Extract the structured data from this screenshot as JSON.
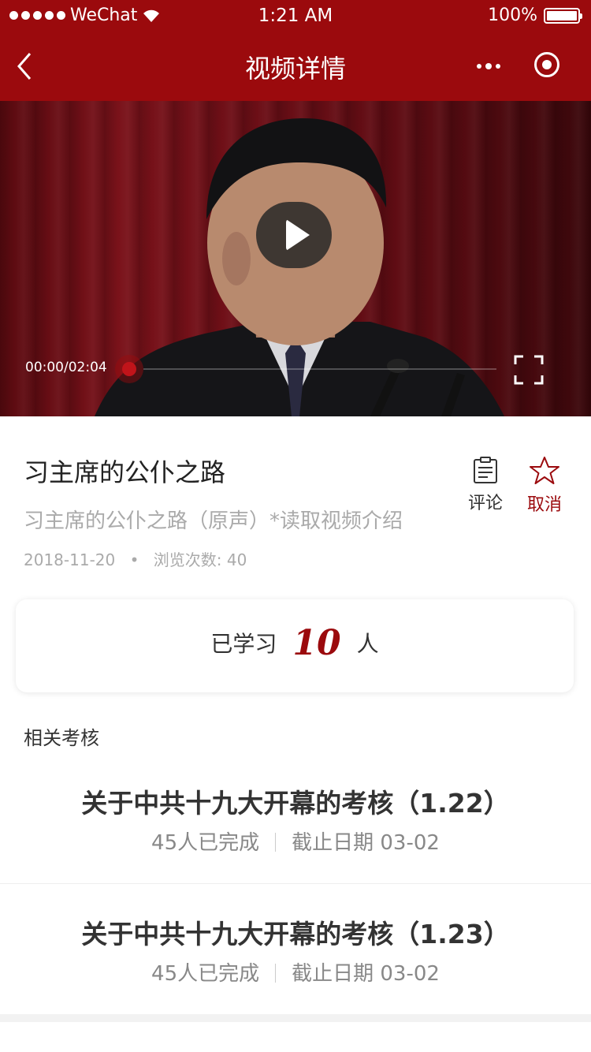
{
  "status_bar": {
    "carrier": "WeChat",
    "time": "1:21 AM",
    "battery": "100%"
  },
  "nav": {
    "title": "视频详情"
  },
  "video": {
    "time_label": "00:00/02:04",
    "progress": 0
  },
  "info": {
    "title": "习主席的公仆之路",
    "description": "习主席的公仆之路（原声）*读取视频介绍",
    "date": "2018-11-20",
    "bullet": "•",
    "views_label": "浏览次数: 40"
  },
  "actions": {
    "comment_label": "评论",
    "favorite_label": "取消"
  },
  "learned": {
    "prefix": "已学习",
    "count": "10",
    "suffix": "人"
  },
  "related": {
    "section_title": "相关考核",
    "items": [
      {
        "title": "关于中共十九大开幕的考核（1.22）",
        "completed": "45人已完成",
        "deadline": "截止日期 03-02"
      },
      {
        "title": "关于中共十九大开幕的考核（1.23）",
        "completed": "45人已完成",
        "deadline": "截止日期 03-02"
      }
    ]
  },
  "colors": {
    "brand": "#9b0a0d"
  },
  "icons": [
    "signal-icon",
    "wifi-icon",
    "battery-icon",
    "back-icon",
    "more-icon",
    "target-icon",
    "play-icon",
    "fullscreen-icon",
    "comment-icon",
    "star-icon"
  ]
}
